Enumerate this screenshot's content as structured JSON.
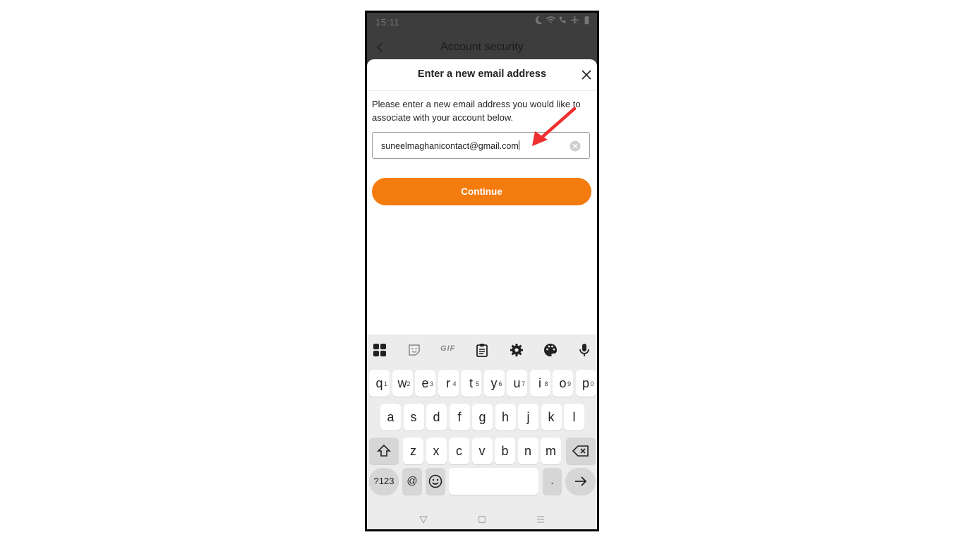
{
  "status_bar": {
    "time": "15:11"
  },
  "app_bar": {
    "title": "Account security"
  },
  "sheet": {
    "title": "Enter a new email address",
    "description": "Please enter a new email address you would like to associate with your account below.",
    "email_value": "suneelmaghanicontact@gmail.com",
    "continue_label": "Continue"
  },
  "colors": {
    "accent": "#f47b0e",
    "annotation_arrow": "#ef3030"
  },
  "keyboard": {
    "toolbar": [
      "apps-icon",
      "sticker-icon",
      "gif-icon",
      "clipboard-icon",
      "settings-icon",
      "palette-icon",
      "microphone-icon"
    ],
    "gif_label": "GIF",
    "row1": [
      {
        "k": "q",
        "h": "1"
      },
      {
        "k": "w",
        "h": "2"
      },
      {
        "k": "e",
        "h": "3"
      },
      {
        "k": "r",
        "h": "4"
      },
      {
        "k": "t",
        "h": "5"
      },
      {
        "k": "y",
        "h": "6"
      },
      {
        "k": "u",
        "h": "7"
      },
      {
        "k": "i",
        "h": "8"
      },
      {
        "k": "o",
        "h": "9"
      },
      {
        "k": "p",
        "h": "0"
      }
    ],
    "row2": [
      "a",
      "s",
      "d",
      "f",
      "g",
      "h",
      "j",
      "k",
      "l"
    ],
    "row3": [
      "z",
      "x",
      "c",
      "v",
      "b",
      "n",
      "m"
    ],
    "symbols_label": "?123",
    "at_label": "@",
    "period_label": "."
  }
}
